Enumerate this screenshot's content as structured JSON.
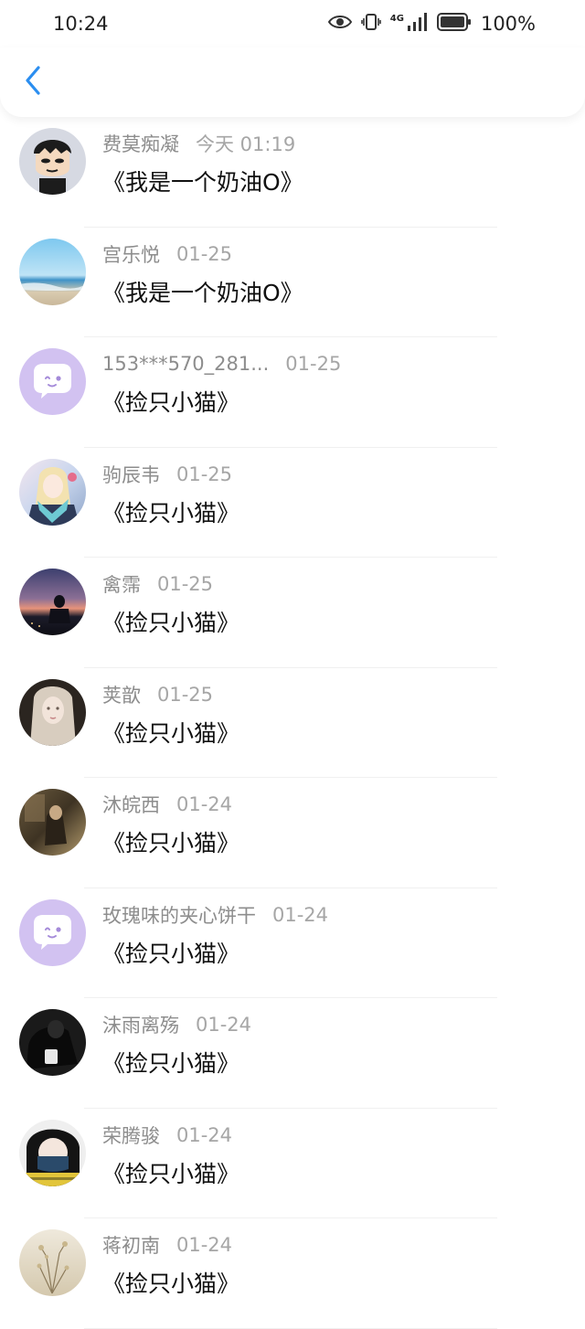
{
  "status": {
    "time": "10:24",
    "network": "4G",
    "battery": "100%"
  },
  "header": {
    "back_icon": "chevron-left-icon",
    "accent": "#2b8ef0"
  },
  "messages": [
    {
      "name": "费莫痴凝",
      "time": "今天 01:19",
      "text": "《我是一个奶油O》",
      "avatar": "cartoon-boy"
    },
    {
      "name": "宫乐悦",
      "time": "01-25",
      "text": "《我是一个奶油O》",
      "avatar": "beach"
    },
    {
      "name": "153***570_281...",
      "time": "01-25",
      "text": "《捡只小猫》",
      "avatar": "default-chat"
    },
    {
      "name": "驹辰韦",
      "time": "01-25",
      "text": "《捡只小猫》",
      "avatar": "anime-girl"
    },
    {
      "name": "禽霈",
      "time": "01-25",
      "text": "《捡只小猫》",
      "avatar": "sunset"
    },
    {
      "name": "荚歆",
      "time": "01-25",
      "text": "《捡只小猫》",
      "avatar": "portrait-girl"
    },
    {
      "name": "沐皖西",
      "time": "01-24",
      "text": "《捡只小猫》",
      "avatar": "sepia-photo"
    },
    {
      "name": "玫瑰味的夹心饼干",
      "time": "01-24",
      "text": "《捡只小猫》",
      "avatar": "default-chat"
    },
    {
      "name": "沫雨离殇",
      "time": "01-24",
      "text": "《捡只小猫》",
      "avatar": "dark-figure"
    },
    {
      "name": "荣腾骏",
      "time": "01-24",
      "text": "《捡只小猫》",
      "avatar": "masked-girl"
    },
    {
      "name": "蒋初南",
      "time": "01-24",
      "text": "《捡只小猫》",
      "avatar": "dried-flowers"
    }
  ]
}
